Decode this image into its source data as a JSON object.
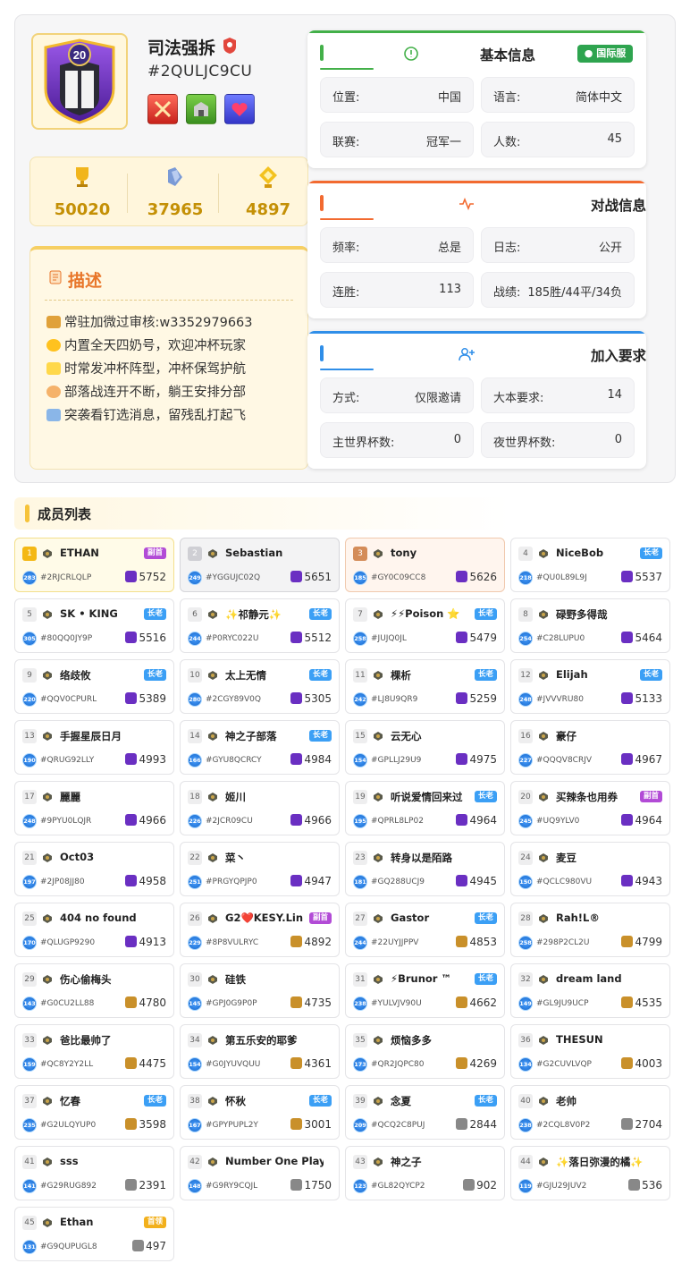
{
  "clan": {
    "name": "司法强拆",
    "tag": "#2QULJC9CU",
    "level": "20",
    "trophies": "50020",
    "builder_trophies": "37965",
    "capital_trophies": "4897"
  },
  "description": {
    "title": "描述",
    "lines": [
      "常驻加微过审核:w3352979663",
      "内置全天四奶号，欢迎冲杯玩家",
      "时常发冲杯阵型，冲杯保驾护航",
      "部落战连开不断，躺王安排分部",
      "突袭看钉选消息，留残乱打起飞"
    ]
  },
  "basic": {
    "title": "基本信息",
    "server_tag": "国际服",
    "items": [
      {
        "k": "位置:",
        "v": "中国"
      },
      {
        "k": "语言:",
        "v": "简体中文"
      },
      {
        "k": "联赛:",
        "v": "冠军一"
      },
      {
        "k": "人数:",
        "v": "45"
      }
    ]
  },
  "war": {
    "title": "对战信息",
    "items": [
      {
        "k": "频率:",
        "v": "总是"
      },
      {
        "k": "日志:",
        "v": "公开"
      },
      {
        "k": "连胜:",
        "v": "113"
      },
      {
        "k": "战绩:",
        "v": "185胜/44平/34负"
      }
    ]
  },
  "join": {
    "title": "加入要求",
    "items": [
      {
        "k": "方式:",
        "v": "仅限邀请"
      },
      {
        "k": "大本要求:",
        "v": "14"
      },
      {
        "k": "主世界杯数:",
        "v": "0"
      },
      {
        "k": "夜世界杯数:",
        "v": "0"
      }
    ]
  },
  "members_title": "成员列表",
  "colors": {
    "accent_gold": "#c49006",
    "elder_blue": "#3b9ff5",
    "coleader_purple": "#b24bd6",
    "leader_gold": "#f2b01c"
  },
  "members": [
    {
      "rank": "1",
      "name": "ETHAN",
      "role": "副首",
      "tag": "#2RJCRLQLP",
      "lv": "283",
      "trophies": "5752"
    },
    {
      "rank": "2",
      "name": "Sebastian",
      "role": "",
      "tag": "#YGGUJC02Q",
      "lv": "249",
      "trophies": "5651"
    },
    {
      "rank": "3",
      "name": "tony",
      "role": "",
      "tag": "#GY0C09CC8",
      "lv": "185",
      "trophies": "5626"
    },
    {
      "rank": "4",
      "name": "NiceBob",
      "role": "长老",
      "tag": "#QU0L89L9J",
      "lv": "218",
      "trophies": "5537"
    },
    {
      "rank": "5",
      "name": "SK • KING",
      "role": "长老",
      "tag": "#80QQ0JY9P",
      "lv": "305",
      "trophies": "5516"
    },
    {
      "rank": "6",
      "name": "✨祁静元✨",
      "role": "长老",
      "tag": "#P0RYC022U",
      "lv": "244",
      "trophies": "5512"
    },
    {
      "rank": "7",
      "name": "⚡⚡Poison ⭐",
      "role": "长老",
      "tag": "#JUJQ0JL",
      "lv": "258",
      "trophies": "5479"
    },
    {
      "rank": "8",
      "name": "碌野多得哉",
      "role": "",
      "tag": "#C28LUPU0",
      "lv": "254",
      "trophies": "5464"
    },
    {
      "rank": "9",
      "name": "络歧攸",
      "role": "长老",
      "tag": "#QQV0CPURL",
      "lv": "220",
      "trophies": "5389"
    },
    {
      "rank": "10",
      "name": "太上无情",
      "role": "长老",
      "tag": "#2CGY89V0Q",
      "lv": "280",
      "trophies": "5305"
    },
    {
      "rank": "11",
      "name": "棵析",
      "role": "长老",
      "tag": "#LJ8U9QR9",
      "lv": "242",
      "trophies": "5259"
    },
    {
      "rank": "12",
      "name": "Elijah",
      "role": "长老",
      "tag": "#JVVVRU80",
      "lv": "248",
      "trophies": "5133"
    },
    {
      "rank": "13",
      "name": "手握星辰日月",
      "role": "",
      "tag": "#QRUG92LLY",
      "lv": "190",
      "trophies": "4993"
    },
    {
      "rank": "14",
      "name": "神之子部落",
      "role": "长老",
      "tag": "#GYU8QCRCY",
      "lv": "166",
      "trophies": "4984"
    },
    {
      "rank": "15",
      "name": "云无心",
      "role": "",
      "tag": "#GPLLJ29U9",
      "lv": "154",
      "trophies": "4975"
    },
    {
      "rank": "16",
      "name": "豪仔",
      "role": "",
      "tag": "#QQQV8CRJV",
      "lv": "227",
      "trophies": "4967"
    },
    {
      "rank": "17",
      "name": "麗麗",
      "role": "",
      "tag": "#9PYU0LQJR",
      "lv": "248",
      "trophies": "4966"
    },
    {
      "rank": "18",
      "name": "姬川",
      "role": "",
      "tag": "#2JCR09CU",
      "lv": "226",
      "trophies": "4966"
    },
    {
      "rank": "19",
      "name": "听说爱情回来过",
      "role": "长老",
      "tag": "#QPRL8LP02",
      "lv": "195",
      "trophies": "4964"
    },
    {
      "rank": "20",
      "name": "买辣条也用券",
      "role": "副首",
      "tag": "#UQ9YLV0",
      "lv": "245",
      "trophies": "4964"
    },
    {
      "rank": "21",
      "name": "Oct03",
      "role": "",
      "tag": "#2JP08JJ80",
      "lv": "197",
      "trophies": "4958"
    },
    {
      "rank": "22",
      "name": "菜丶",
      "role": "",
      "tag": "#PRGYQPJP0",
      "lv": "251",
      "trophies": "4947"
    },
    {
      "rank": "23",
      "name": "转身以是陌路",
      "role": "",
      "tag": "#GQ288UCJ9",
      "lv": "181",
      "trophies": "4945"
    },
    {
      "rank": "24",
      "name": "麦豆",
      "role": "",
      "tag": "#QCLC980VU",
      "lv": "150",
      "trophies": "4943"
    },
    {
      "rank": "25",
      "name": "404 no found",
      "role": "",
      "tag": "#QLUGP9290",
      "lv": "170",
      "trophies": "4913"
    },
    {
      "rank": "26",
      "name": "G2❤️KESY.Lin",
      "role": "副首",
      "tag": "#8P8VULRYC",
      "lv": "229",
      "trophies": "4892"
    },
    {
      "rank": "27",
      "name": "Gastor",
      "role": "长老",
      "tag": "#22UYJJPPV",
      "lv": "244",
      "trophies": "4853"
    },
    {
      "rank": "28",
      "name": "Rah!L®",
      "role": "",
      "tag": "#298P2CL2U",
      "lv": "258",
      "trophies": "4799"
    },
    {
      "rank": "29",
      "name": "伤心偷梅头",
      "role": "",
      "tag": "#G0CU2LL88",
      "lv": "143",
      "trophies": "4780"
    },
    {
      "rank": "30",
      "name": "硅铁",
      "role": "",
      "tag": "#GPJ0G9P0P",
      "lv": "145",
      "trophies": "4735"
    },
    {
      "rank": "31",
      "name": "⚡Brunor ™",
      "role": "长老",
      "tag": "#YULVJV90U",
      "lv": "238",
      "trophies": "4662"
    },
    {
      "rank": "32",
      "name": "dream land",
      "role": "",
      "tag": "#GL9JU9UCP",
      "lv": "149",
      "trophies": "4535"
    },
    {
      "rank": "33",
      "name": "爸比最帅了",
      "role": "",
      "tag": "#QC8Y2Y2LL",
      "lv": "159",
      "trophies": "4475"
    },
    {
      "rank": "34",
      "name": "第五乐安的耶爹",
      "role": "",
      "tag": "#G0JYUVQUU",
      "lv": "154",
      "trophies": "4361"
    },
    {
      "rank": "35",
      "name": "烦恼多多",
      "role": "",
      "tag": "#QR2JQPC80",
      "lv": "173",
      "trophies": "4269"
    },
    {
      "rank": "36",
      "name": "THESUN",
      "role": "",
      "tag": "#G2CUVLVQP",
      "lv": "134",
      "trophies": "4003"
    },
    {
      "rank": "37",
      "name": "忆春",
      "role": "长老",
      "tag": "#G2ULQYUP0",
      "lv": "235",
      "trophies": "3598"
    },
    {
      "rank": "38",
      "name": "怀秋",
      "role": "长老",
      "tag": "#GPYPUPL2Y",
      "lv": "167",
      "trophies": "3001"
    },
    {
      "rank": "39",
      "name": "念夏",
      "role": "长老",
      "tag": "#QCQ2C8PUJ",
      "lv": "209",
      "trophies": "2844"
    },
    {
      "rank": "40",
      "name": "老帅",
      "role": "",
      "tag": "#2CQL8V0P2",
      "lv": "238",
      "trophies": "2704"
    },
    {
      "rank": "41",
      "name": "sss",
      "role": "",
      "tag": "#G29RUG892",
      "lv": "141",
      "trophies": "2391"
    },
    {
      "rank": "42",
      "name": "Number One Play",
      "role": "",
      "tag": "#G9RY9CQJL",
      "lv": "148",
      "trophies": "1750"
    },
    {
      "rank": "43",
      "name": "神之子",
      "role": "",
      "tag": "#GL82QYCP2",
      "lv": "123",
      "trophies": "902"
    },
    {
      "rank": "44",
      "name": "✨落日弥漫的橘✨",
      "role": "",
      "tag": "#GJU29JUV2",
      "lv": "119",
      "trophies": "536"
    },
    {
      "rank": "45",
      "name": "Ethan",
      "role": "首领",
      "tag": "#G9QUPUGL8",
      "lv": "131",
      "trophies": "497"
    }
  ]
}
